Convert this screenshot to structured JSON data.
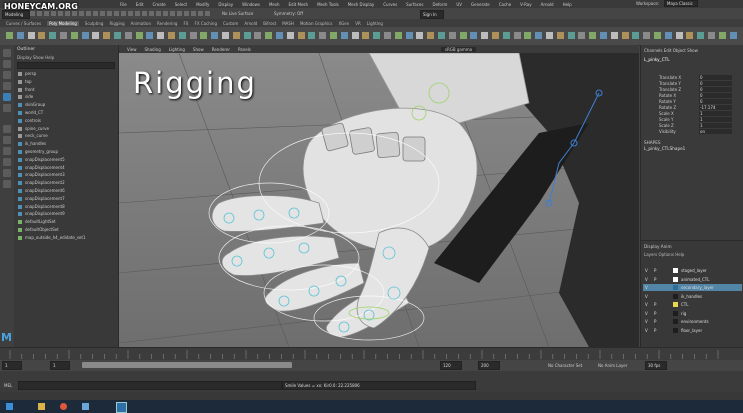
{
  "watermark": "HONEYCAM.ORG",
  "menubar": [
    "File",
    "Edit",
    "Create",
    "Select",
    "Modify",
    "Display",
    "Windows",
    "Mesh",
    "Edit Mesh",
    "Mesh Tools",
    "Mesh Display",
    "Curves",
    "Surfaces",
    "Deform",
    "UV",
    "Generate",
    "Cache",
    "V-Ray",
    "Arnold",
    "Help"
  ],
  "workspace_label": "Workspace:",
  "workspace_value": "Maya Classic",
  "mode_dropdown": "Modeling",
  "live_surface": "No Live Surface",
  "symmetry": "Symmetry: Off",
  "sign_in": "Sign In",
  "shelf_tabs": [
    "Curves / Surfaces",
    "Poly Modeling",
    "Sculpting",
    "Rigging",
    "Animation",
    "Rendering",
    "FX",
    "FX Caching",
    "Custom",
    "Arnold",
    "Bifrost",
    "MASH",
    "Motion Graphics",
    "XGen",
    "VR",
    "Lighting"
  ],
  "shelf_active": "Poly Modeling",
  "outliner": {
    "title": "Outliner",
    "menu": "Display   Show   Help",
    "items": [
      {
        "label": "persp",
        "icon": "grey"
      },
      {
        "label": "top",
        "icon": "grey"
      },
      {
        "label": "front",
        "icon": "grey"
      },
      {
        "label": "side",
        "icon": "grey"
      },
      {
        "label": "skinGroup",
        "icon": "blue"
      },
      {
        "label": "world_CT",
        "icon": "blue"
      },
      {
        "label": "controls",
        "icon": "blue"
      },
      {
        "label": "spine_curve",
        "icon": "grey"
      },
      {
        "label": "neck_curve",
        "icon": "grey"
      },
      {
        "label": "ik_handles",
        "icon": "blue"
      },
      {
        "label": "geometry_group",
        "icon": "blue"
      },
      {
        "label": "snapDisplacement5",
        "icon": "blue"
      },
      {
        "label": "snapDisplacement4",
        "icon": "blue"
      },
      {
        "label": "snapDisplacement3",
        "icon": "blue"
      },
      {
        "label": "snapDisplacement2",
        "icon": "blue"
      },
      {
        "label": "snapDisplacement6",
        "icon": "blue"
      },
      {
        "label": "snapDisplacement7",
        "icon": "blue"
      },
      {
        "label": "snapDisplacement8",
        "icon": "blue"
      },
      {
        "label": "snapDisplacement9",
        "icon": "blue"
      },
      {
        "label": "defaultLightSet",
        "icon": "green"
      },
      {
        "label": "defaultObjectSet",
        "icon": "green"
      },
      {
        "label": "map_outside_h4_edidate_set1",
        "icon": "green"
      }
    ]
  },
  "viewport": {
    "menu": [
      "View",
      "Shading",
      "Lighting",
      "Show",
      "Renderer",
      "Panels"
    ],
    "camera_dropdown": "sRGB gamma",
    "overlay_title": "Rigging"
  },
  "channelbox": {
    "menu": "Channels   Edit   Object   Show",
    "object": "L_pinky_CTL",
    "attrs": [
      {
        "name": "Translate X",
        "value": "0"
      },
      {
        "name": "Translate Y",
        "value": "0"
      },
      {
        "name": "Translate Z",
        "value": "0"
      },
      {
        "name": "Rotate X",
        "value": "0"
      },
      {
        "name": "Rotate Y",
        "value": "0"
      },
      {
        "name": "Rotate Z",
        "value": "-17.174"
      },
      {
        "name": "Scale X",
        "value": "1"
      },
      {
        "name": "Scale Y",
        "value": "1"
      },
      {
        "name": "Scale Z",
        "value": "1"
      },
      {
        "name": "Visibility",
        "value": "on"
      }
    ],
    "shapes_header": "SHAPES",
    "shapes_name": "L_pinky_CTLShape1"
  },
  "layers": {
    "tabs": "Display   Anim",
    "menu": "Layers   Options   Help",
    "items": [
      {
        "v": "V",
        "p": "P",
        "color": "#ffffff",
        "name": "staged_layer",
        "selected": false
      },
      {
        "v": "V",
        "p": "P",
        "color": "#ffffff",
        "name": "animated_CTL",
        "selected": false
      },
      {
        "v": "V",
        "p": "",
        "color": "#2d6f9a",
        "name": "secondary_layer",
        "selected": true
      },
      {
        "v": "V",
        "p": "",
        "color": "#1e1e1e",
        "name": "ik_handles",
        "selected": false
      },
      {
        "v": "V",
        "p": "P",
        "color": "#e7d84c",
        "name": "CTL",
        "selected": false
      },
      {
        "v": "V",
        "p": "P",
        "color": "#1e1e1e",
        "name": "rig",
        "selected": false
      },
      {
        "v": "V",
        "p": "P",
        "color": "#1e1e1e",
        "name": "environments",
        "selected": false
      },
      {
        "v": "V",
        "p": "P",
        "color": "#1e1e1e",
        "name": "floor_layer",
        "selected": false
      }
    ]
  },
  "timeline": {
    "start": "1",
    "current": "1",
    "range_start": "120",
    "range_end": "120",
    "range_end2": "200",
    "no_character_set": "No Character Set",
    "no_anim_layer": "No Anim Layer",
    "fps": "30 fps"
  },
  "command": {
    "label": "MEL",
    "result": "Smile Values = xx: Kir0.0: 22.225806"
  },
  "taskbar_icons": [
    "windows-icon",
    "folder-icon",
    "browser-icon",
    "mail-icon",
    "maya-icon"
  ],
  "colors": {
    "selection": "#5285a6",
    "accent": "#3b7fb4"
  }
}
